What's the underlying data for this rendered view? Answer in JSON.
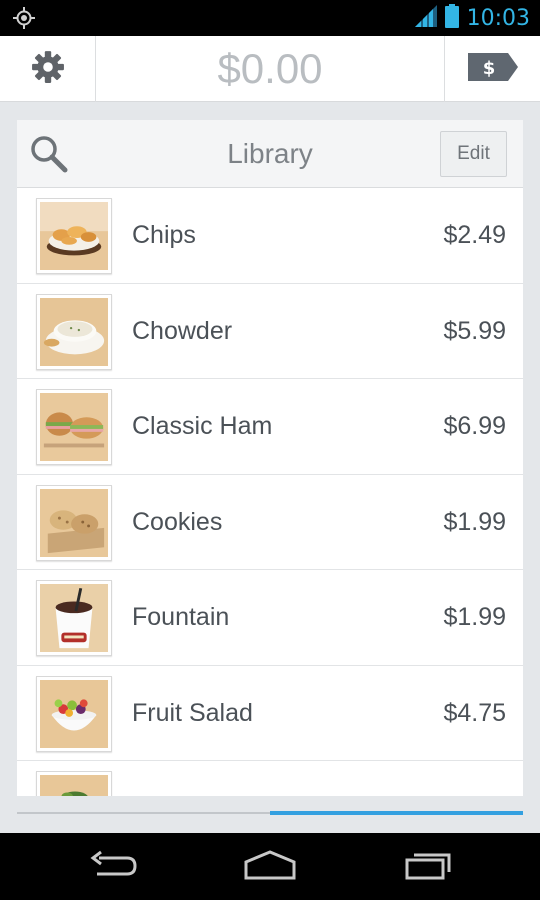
{
  "status_bar": {
    "time": "10:03",
    "icons": [
      "location-icon",
      "signal-icon",
      "battery-icon"
    ],
    "accent_color": "#33b5e5"
  },
  "action_bar": {
    "total": "$0.00",
    "settings_icon": "gear-icon",
    "charge_icon": "price-tag-icon"
  },
  "library": {
    "title": "Library",
    "edit_label": "Edit",
    "search_icon": "search-icon",
    "items": [
      {
        "name": "Chips",
        "price": "$2.49"
      },
      {
        "name": "Chowder",
        "price": "$5.99"
      },
      {
        "name": "Classic Ham",
        "price": "$6.99"
      },
      {
        "name": "Cookies",
        "price": "$1.99"
      },
      {
        "name": "Fountain",
        "price": "$1.99"
      },
      {
        "name": "Fruit Salad",
        "price": "$4.75"
      },
      {
        "name": "",
        "price": ""
      }
    ]
  },
  "pager": {
    "active_page": 2,
    "page_count": 2,
    "active_color": "#33a0e0"
  },
  "nav_bar": {
    "icons": [
      "back-icon",
      "home-icon",
      "recent-apps-icon"
    ]
  }
}
